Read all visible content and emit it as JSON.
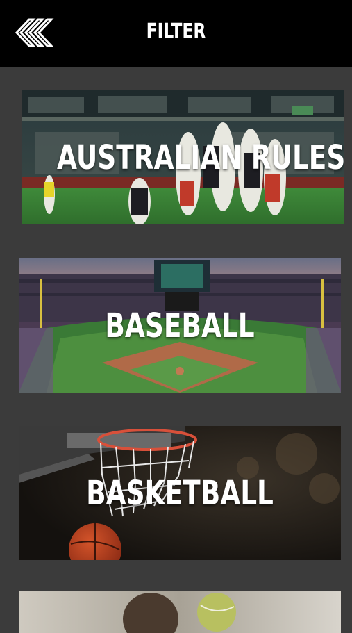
{
  "header": {
    "title": "FILTER",
    "back_icon": "double-chevron-left-icon"
  },
  "sports": [
    {
      "label": "AUSTRALIAN RULES"
    },
    {
      "label": "BASEBALL"
    },
    {
      "label": "BASKETBALL"
    },
    {
      "label": ""
    }
  ],
  "colors": {
    "header_bg": "#000000",
    "page_bg": "#3b3b3b",
    "label": "#ffffff"
  }
}
